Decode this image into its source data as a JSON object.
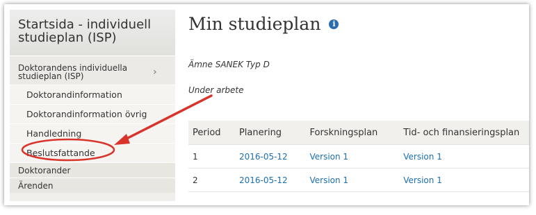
{
  "sidebar": {
    "title": "Startsida - individuell studieplan (ISP)",
    "parent_item": "Doktorandens individuella studieplan (ISP)",
    "sub_items": [
      "Doktorandinformation",
      "Doktorandinformation övrig",
      "Handledning",
      "Beslutsfattande"
    ],
    "top_items": [
      "Doktorander",
      "Ärenden"
    ]
  },
  "main": {
    "title": "Min studieplan",
    "subject": "Ämne SANEK Typ D",
    "status": "Under arbete",
    "table": {
      "headers": [
        "Period",
        "Planering",
        "Forskningsplan",
        "Tid- och finansieringsplan"
      ],
      "rows": [
        {
          "period": "1",
          "planering": "2016-05-12",
          "forskningsplan": "Version 1",
          "tid": "Version 1"
        },
        {
          "period": "2",
          "planering": "2016-05-12",
          "forskningsplan": "Version 1",
          "tid": "Version 1"
        }
      ]
    }
  },
  "annotation": {
    "color": "#d9342b",
    "highlighted_item": "Beslutsfattande"
  }
}
